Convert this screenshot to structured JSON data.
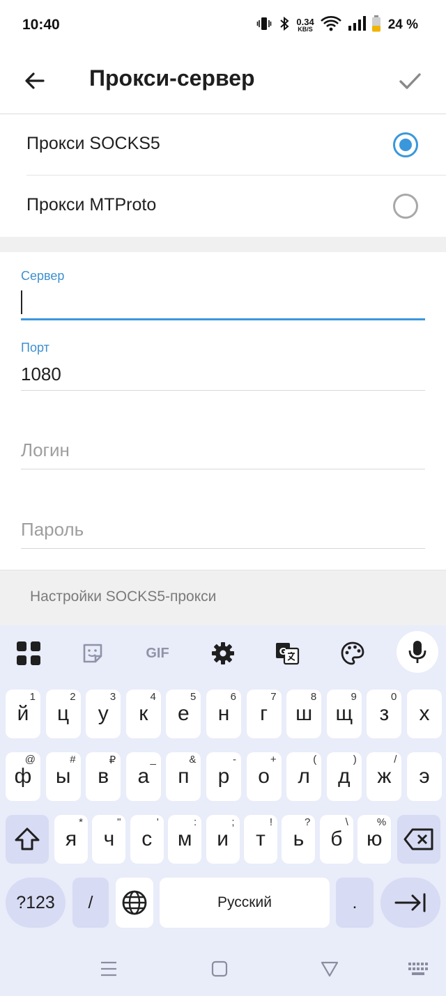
{
  "status_bar": {
    "time": "10:40",
    "speed_value": "0.34",
    "speed_unit": "KB/S",
    "battery_percent": "24 %"
  },
  "app_bar": {
    "title": "Прокси-сервер"
  },
  "proxy_types": [
    {
      "label": "Прокси SOCKS5",
      "selected": true
    },
    {
      "label": "Прокси MTProto",
      "selected": false
    }
  ],
  "fields": {
    "server": {
      "label": "Сервер",
      "value": ""
    },
    "port": {
      "label": "Порт",
      "value": "1080"
    },
    "login": {
      "placeholder": "Логин"
    },
    "password": {
      "placeholder": "Пароль"
    }
  },
  "footer_note": "Настройки SOCKS5-прокси",
  "keyboard": {
    "toolbar": {
      "gif_label": "GIF"
    },
    "row1": [
      {
        "key": "й",
        "hint": "1"
      },
      {
        "key": "ц",
        "hint": "2"
      },
      {
        "key": "у",
        "hint": "3"
      },
      {
        "key": "к",
        "hint": "4"
      },
      {
        "key": "е",
        "hint": "5"
      },
      {
        "key": "н",
        "hint": "6"
      },
      {
        "key": "г",
        "hint": "7"
      },
      {
        "key": "ш",
        "hint": "8"
      },
      {
        "key": "щ",
        "hint": "9"
      },
      {
        "key": "з",
        "hint": "0"
      },
      {
        "key": "х",
        "hint": ""
      }
    ],
    "row2": [
      {
        "key": "ф",
        "hint": "@"
      },
      {
        "key": "ы",
        "hint": "#"
      },
      {
        "key": "в",
        "hint": "₽"
      },
      {
        "key": "а",
        "hint": "_"
      },
      {
        "key": "п",
        "hint": "&"
      },
      {
        "key": "р",
        "hint": "-"
      },
      {
        "key": "о",
        "hint": "+"
      },
      {
        "key": "л",
        "hint": "("
      },
      {
        "key": "д",
        "hint": ")"
      },
      {
        "key": "ж",
        "hint": "/"
      },
      {
        "key": "э",
        "hint": ""
      }
    ],
    "row3": [
      {
        "key": "я",
        "hint": "*"
      },
      {
        "key": "ч",
        "hint": "\""
      },
      {
        "key": "с",
        "hint": "'"
      },
      {
        "key": "м",
        "hint": ":"
      },
      {
        "key": "и",
        "hint": ";"
      },
      {
        "key": "т",
        "hint": "!"
      },
      {
        "key": "ь",
        "hint": "?"
      },
      {
        "key": "б",
        "hint": "\\"
      },
      {
        "key": "ю",
        "hint": "%"
      }
    ],
    "symbols_label": "?123",
    "slash_label": "/",
    "space_label": "Русский",
    "period_label": "."
  },
  "colors": {
    "accent": "#3a97dc",
    "keyboard_bg": "#e9ecf9",
    "modifier_key": "#d7dbf3"
  }
}
